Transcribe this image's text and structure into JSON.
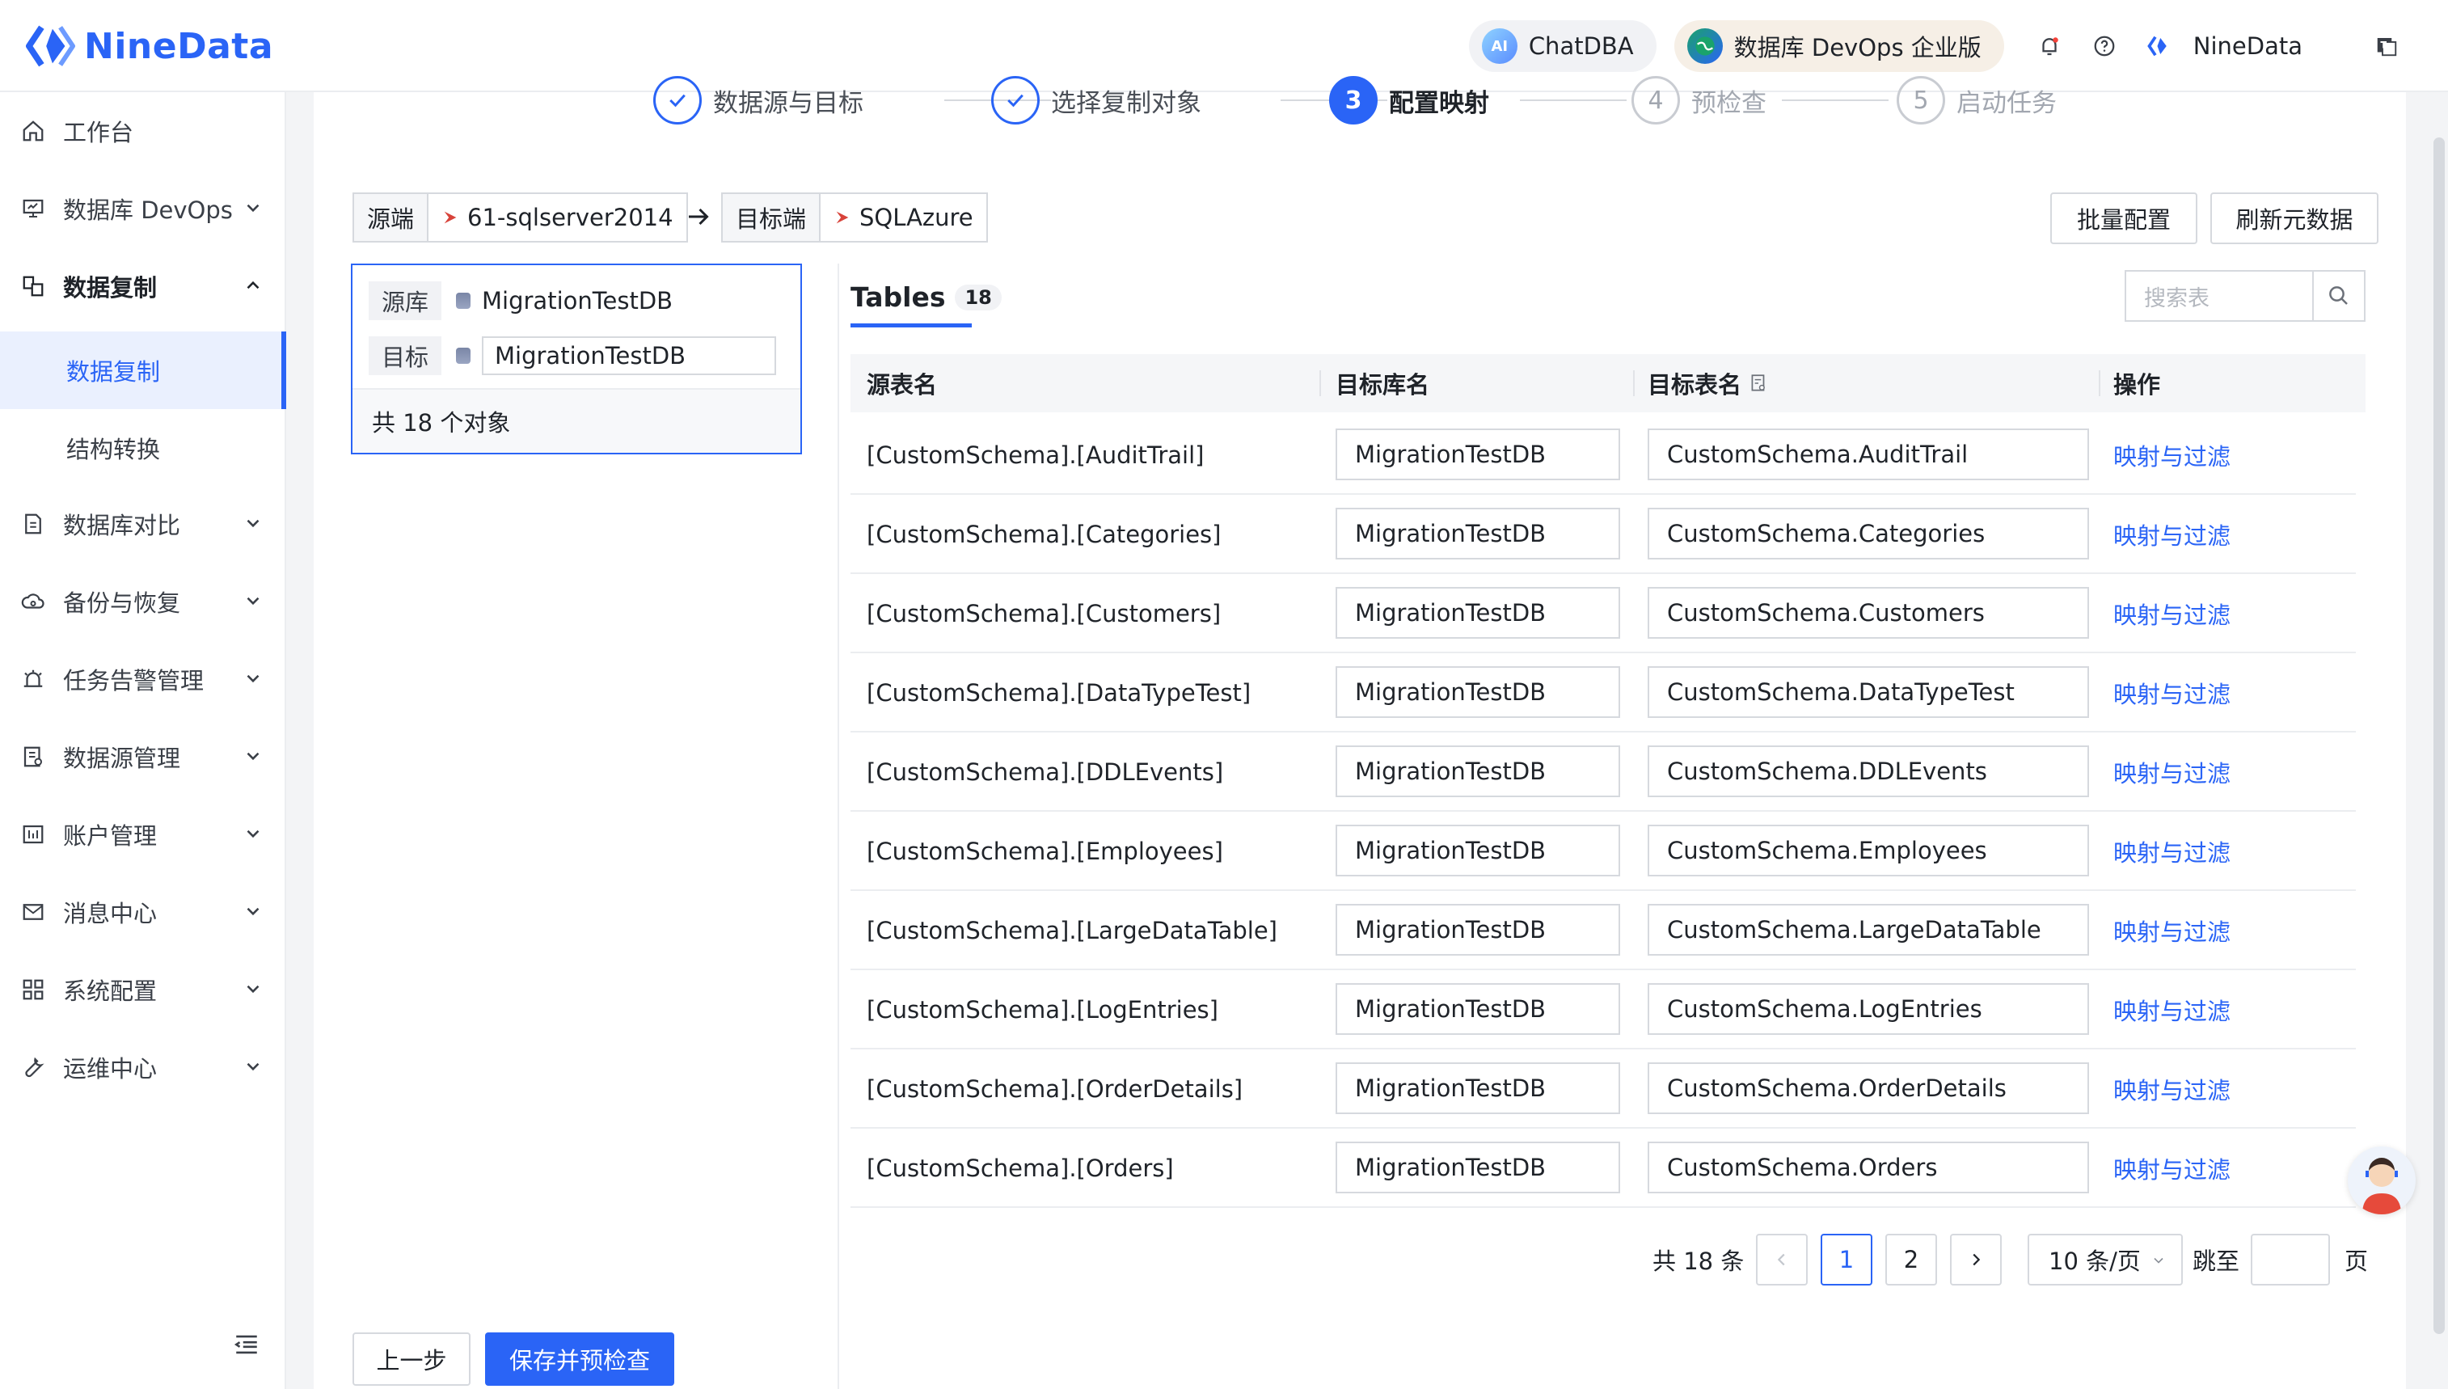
{
  "brand": {
    "name": "NineData",
    "color": "#2a64f6"
  },
  "header": {
    "chatdba_label": "ChatDBA",
    "chatdba_icon_text": "AI",
    "devops_label": "数据库 DevOps 企业版",
    "user_name": "NineData"
  },
  "sidebar": {
    "items": [
      {
        "label": "工作台",
        "icon": "home-icon"
      },
      {
        "label": "数据库 DevOps",
        "icon": "monitor-icon"
      },
      {
        "label": "数据复制",
        "icon": "replication-icon"
      },
      {
        "label": "数据复制"
      },
      {
        "label": "结构转换"
      },
      {
        "label": "数据库对比",
        "icon": "compare-icon"
      },
      {
        "label": "备份与恢复",
        "icon": "backup-icon"
      },
      {
        "label": "任务告警管理",
        "icon": "alarm-icon"
      },
      {
        "label": "数据源管理",
        "icon": "datasource-icon"
      },
      {
        "label": "账户管理",
        "icon": "account-icon"
      },
      {
        "label": "消息中心",
        "icon": "mail-icon"
      },
      {
        "label": "系统配置",
        "icon": "grid-icon"
      },
      {
        "label": "运维中心",
        "icon": "wrench-icon"
      }
    ]
  },
  "steps": [
    {
      "label": "数据源与目标",
      "state": "done"
    },
    {
      "label": "选择复制对象",
      "state": "done"
    },
    {
      "num": "3",
      "label": "配置映射",
      "state": "current"
    },
    {
      "num": "4",
      "label": "预检查",
      "state": "todo"
    },
    {
      "num": "5",
      "label": "启动任务",
      "state": "todo"
    }
  ],
  "route": {
    "source_label": "源端",
    "source_value": "61-sqlserver2014",
    "target_label": "目标端",
    "target_value": "SQLAzure"
  },
  "actions": {
    "batch": "批量配置",
    "refresh": "刷新元数据"
  },
  "db_card": {
    "source_label": "源库",
    "source_db": "MigrationTestDB",
    "target_label": "目标",
    "target_db": "MigrationTestDB",
    "total": "共 18 个对象"
  },
  "tables_tab": {
    "title": "Tables",
    "count": "18"
  },
  "search": {
    "placeholder": "搜索表"
  },
  "columns": {
    "source": "源表名",
    "target_db": "目标库名",
    "target_table": "目标表名",
    "op": "操作"
  },
  "rows": [
    {
      "src": "[CustomSchema].[AuditTrail]",
      "db": "MigrationTestDB",
      "tb": "CustomSchema.AuditTrail",
      "op": "映射与过滤"
    },
    {
      "src": "[CustomSchema].[Categories]",
      "db": "MigrationTestDB",
      "tb": "CustomSchema.Categories",
      "op": "映射与过滤"
    },
    {
      "src": "[CustomSchema].[Customers]",
      "db": "MigrationTestDB",
      "tb": "CustomSchema.Customers",
      "op": "映射与过滤"
    },
    {
      "src": "[CustomSchema].[DataTypeTest]",
      "db": "MigrationTestDB",
      "tb": "CustomSchema.DataTypeTest",
      "op": "映射与过滤"
    },
    {
      "src": "[CustomSchema].[DDLEvents]",
      "db": "MigrationTestDB",
      "tb": "CustomSchema.DDLEvents",
      "op": "映射与过滤"
    },
    {
      "src": "[CustomSchema].[Employees]",
      "db": "MigrationTestDB",
      "tb": "CustomSchema.Employees",
      "op": "映射与过滤"
    },
    {
      "src": "[CustomSchema].[LargeDataTable]",
      "db": "MigrationTestDB",
      "tb": "CustomSchema.LargeDataTable",
      "op": "映射与过滤"
    },
    {
      "src": "[CustomSchema].[LogEntries]",
      "db": "MigrationTestDB",
      "tb": "CustomSchema.LogEntries",
      "op": "映射与过滤"
    },
    {
      "src": "[CustomSchema].[OrderDetails]",
      "db": "MigrationTestDB",
      "tb": "CustomSchema.OrderDetails",
      "op": "映射与过滤"
    },
    {
      "src": "[CustomSchema].[Orders]",
      "db": "MigrationTestDB",
      "tb": "CustomSchema.Orders",
      "op": "映射与过滤"
    }
  ],
  "pagination": {
    "total": "共 18 条",
    "page1": "1",
    "page2": "2",
    "size": "10 条/页",
    "jump_label": "跳至",
    "page_unit": "页"
  },
  "footer": {
    "prev": "上一步",
    "next": "保存并预检查"
  }
}
